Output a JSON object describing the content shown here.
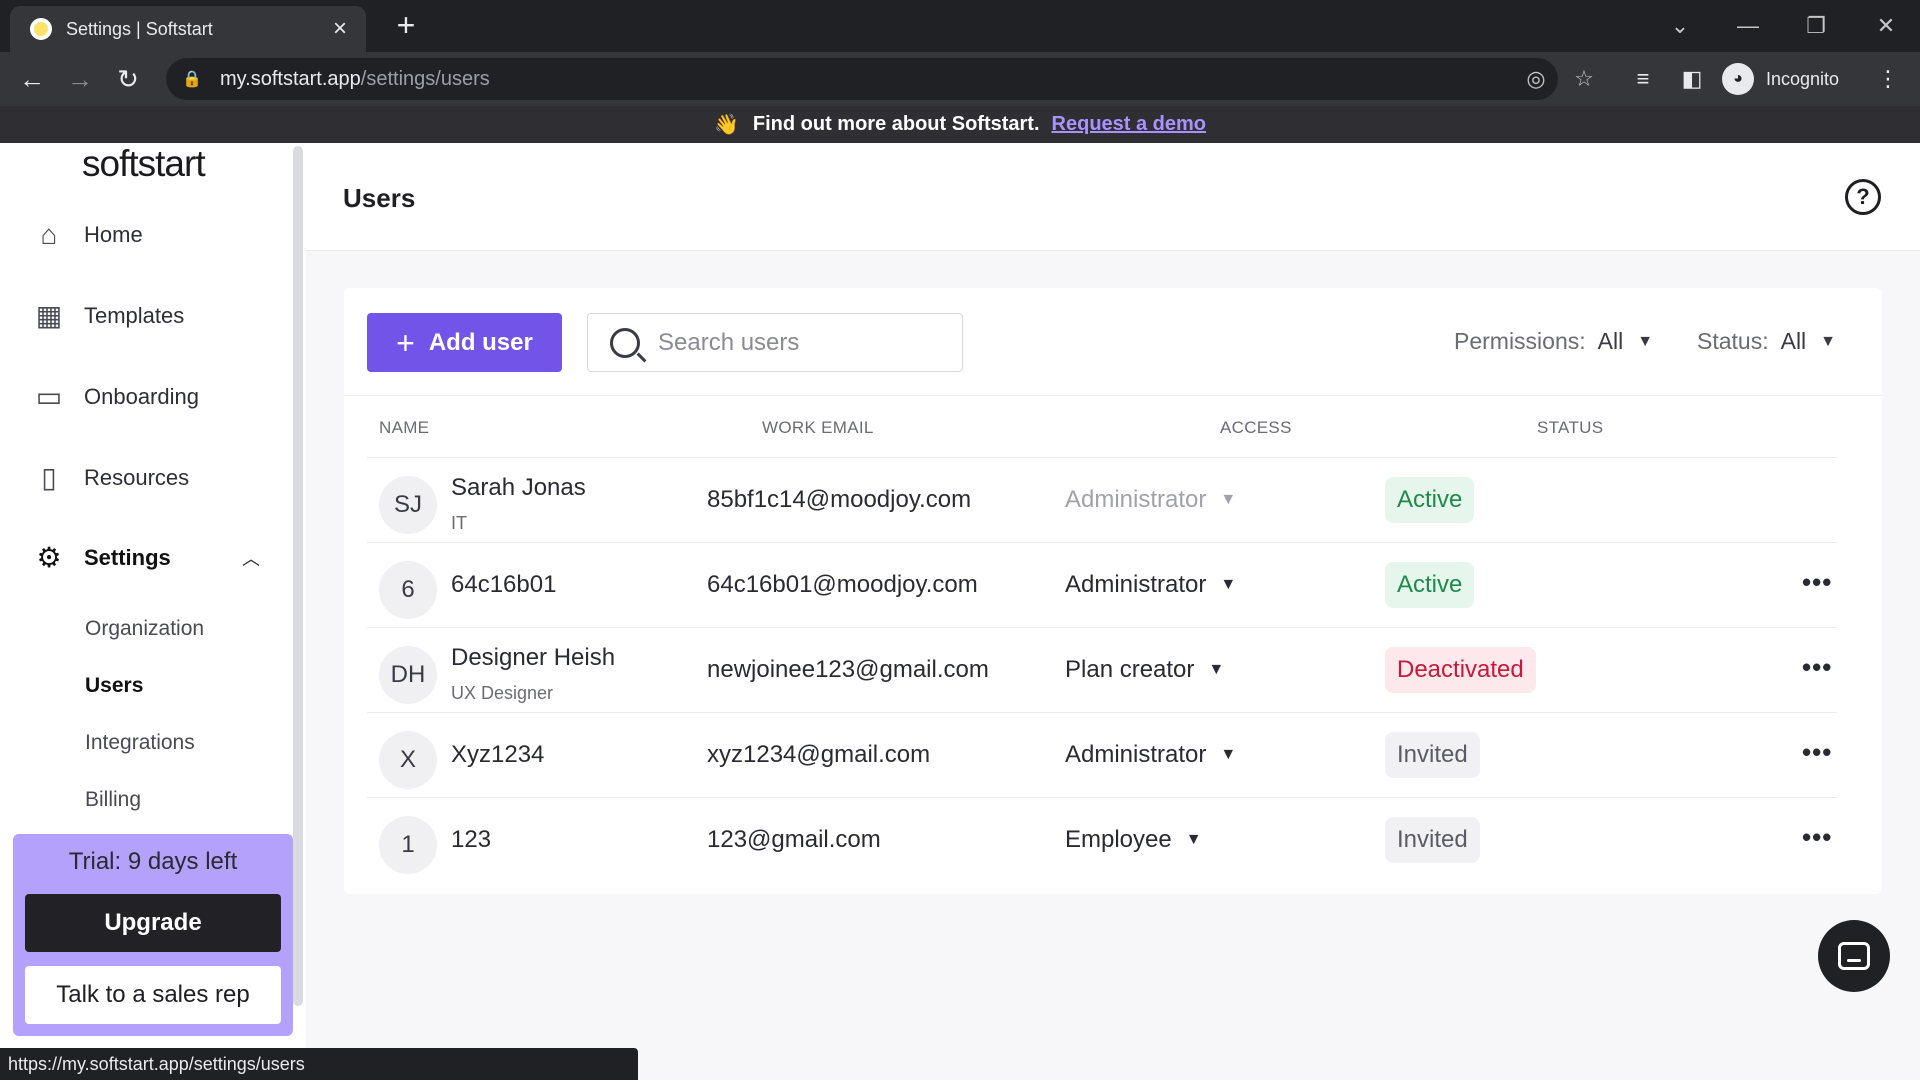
{
  "browser": {
    "tab_title": "Settings | Softstart",
    "url_host": "my.softstart.app",
    "url_path": "/settings/users",
    "incognito_label": "Incognito",
    "status_url": "https://my.softstart.app/settings/users"
  },
  "announcement": {
    "icon": "👋",
    "message": "Find out more about Softstart.",
    "link": "Request a demo"
  },
  "sidebar": {
    "logo": "softstart",
    "items": [
      {
        "label": "Home",
        "icon": "home-icon"
      },
      {
        "label": "Templates",
        "icon": "templates-icon"
      },
      {
        "label": "Onboarding",
        "icon": "calendar-icon"
      },
      {
        "label": "Resources",
        "icon": "book-icon"
      },
      {
        "label": "Settings",
        "icon": "gear-icon"
      }
    ],
    "settings_sub": [
      "Organization",
      "Users",
      "Integrations",
      "Billing"
    ],
    "trial_text": "Trial: 9 days left",
    "upgrade_label": "Upgrade",
    "sales_label": "Talk to a sales rep"
  },
  "page": {
    "title": "Users",
    "help": "?"
  },
  "toolbar": {
    "add_user": "Add user",
    "search_placeholder": "Search users",
    "permissions_label": "Permissions:",
    "permissions_value": "All",
    "status_label": "Status:",
    "status_value": "All"
  },
  "table": {
    "headers": [
      "NAME",
      "WORK EMAIL",
      "ACCESS",
      "STATUS"
    ],
    "rows": [
      {
        "initials": "SJ",
        "name": "Sarah Jonas",
        "sub": "IT",
        "email": "85bf1c14@moodjoy.com",
        "access": "Administrator",
        "status": "Active"
      },
      {
        "initials": "6",
        "name": "64c16b01",
        "sub": "",
        "email": "64c16b01@moodjoy.com",
        "access": "Administrator",
        "status": "Active"
      },
      {
        "initials": "DH",
        "name": "Designer Heish",
        "sub": "UX Designer",
        "email": "newjoinee123@gmail.com",
        "access": "Plan creator",
        "status": "Deactivated"
      },
      {
        "initials": "X",
        "name": "Xyz1234",
        "sub": "",
        "email": "xyz1234@gmail.com",
        "access": "Administrator",
        "status": "Invited"
      },
      {
        "initials": "1",
        "name": "123",
        "sub": "",
        "email": "123@gmail.com",
        "access": "Employee",
        "status": "Invited"
      }
    ]
  },
  "colors": {
    "brand": "#7254e9",
    "trial_bg": "#b4a1fb",
    "active": "#1d8a4c",
    "deactivated": "#c8183b"
  }
}
